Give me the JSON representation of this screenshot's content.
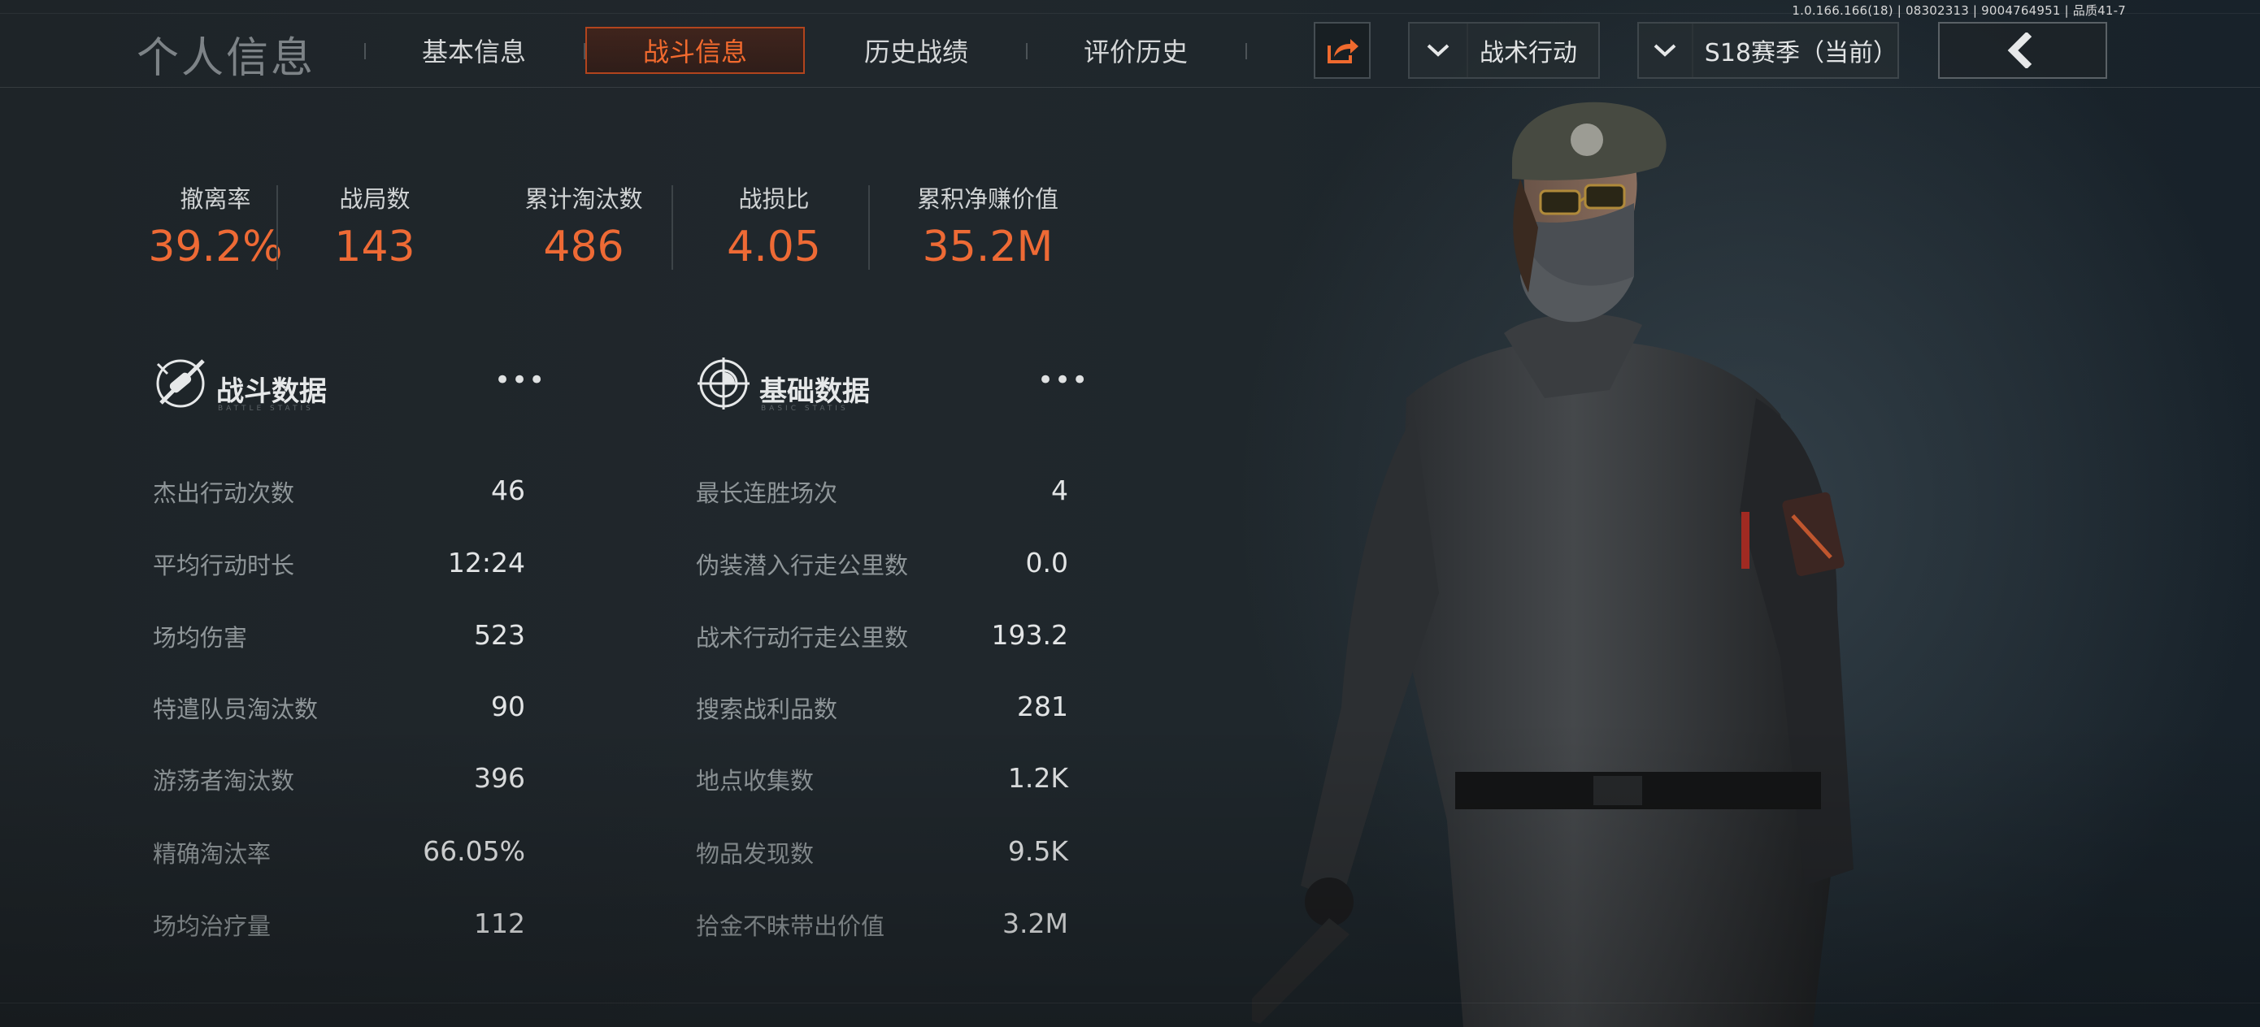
{
  "build_info": "1.0.166.166(18) | 08302313 | 9004764951 | 品质41-7",
  "header": {
    "title": "个人信息",
    "tabs": [
      {
        "label": "基本信息",
        "active": false
      },
      {
        "label": "战斗信息",
        "active": true
      },
      {
        "label": "历史战绩",
        "active": false
      },
      {
        "label": "评价历史",
        "active": false
      }
    ],
    "share_icon": "share-icon",
    "mode_dropdown": "战术行动",
    "season_dropdown": "S18赛季（当前）",
    "back_icon": "chevron-left-icon"
  },
  "summary": [
    {
      "label": "撤离率",
      "value": "39.2%"
    },
    {
      "label": "战局数",
      "value": "143"
    },
    {
      "label": "累计淘汰数",
      "value": "486"
    },
    {
      "label": "战损比",
      "value": "4.05"
    },
    {
      "label": "累积净赚价值",
      "value": "35.2M"
    }
  ],
  "battle_section": {
    "title": "战斗数据",
    "subtitle": "BATTLE STATIS",
    "more": "•••",
    "rows": [
      {
        "label": "杰出行动次数",
        "value": "46"
      },
      {
        "label": "平均行动时长",
        "value": "12:24"
      },
      {
        "label": "场均伤害",
        "value": "523"
      },
      {
        "label": "特遣队员淘汰数",
        "value": "90"
      },
      {
        "label": "游荡者淘汰数",
        "value": "396"
      },
      {
        "label": "精确淘汰率",
        "value": "66.05%"
      },
      {
        "label": "场均治疗量",
        "value": "112"
      }
    ]
  },
  "basic_section": {
    "title": "基础数据",
    "subtitle": "BASIC STATIS",
    "more": "•••",
    "rows": [
      {
        "label": "最长连胜场次",
        "value": "4"
      },
      {
        "label": "伪装潜入行走公里数",
        "value": "0.0"
      },
      {
        "label": "战术行动行走公里数",
        "value": "193.2"
      },
      {
        "label": "搜索战利品数",
        "value": "281"
      },
      {
        "label": "地点收集数",
        "value": "1.2K"
      },
      {
        "label": "物品发现数",
        "value": "9.5K"
      },
      {
        "label": "拾金不昧带出价值",
        "value": "3.2M"
      }
    ]
  },
  "colors": {
    "accent": "#ee6a35",
    "tab_active": "#f26a2e",
    "background": "#1e2428"
  }
}
